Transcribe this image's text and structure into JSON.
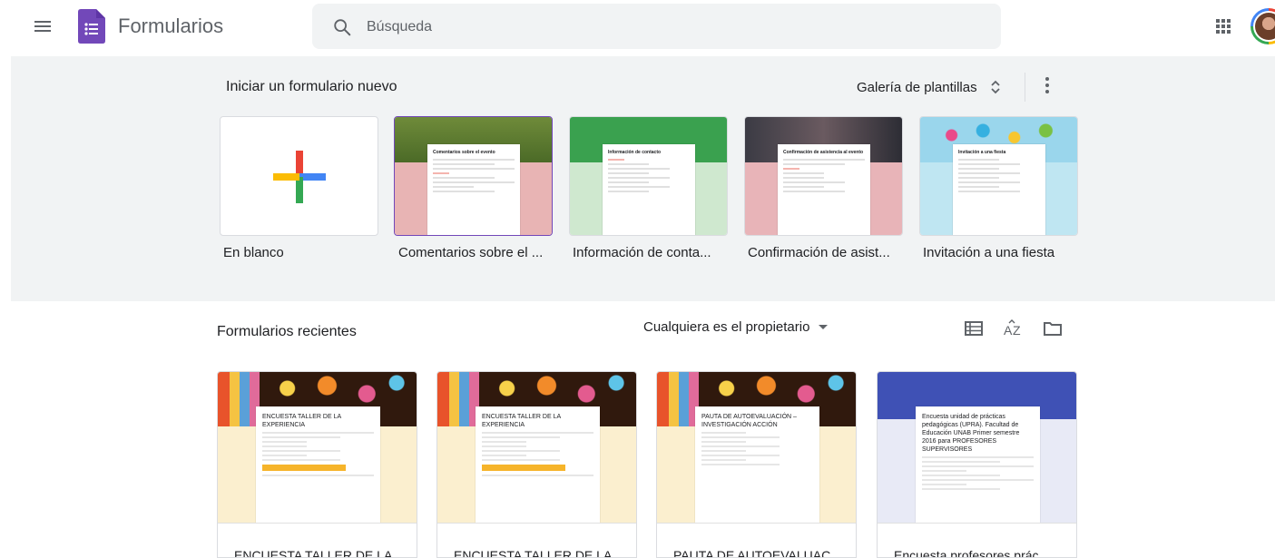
{
  "header": {
    "app_title": "Formularios",
    "search_placeholder": "Búsqueda"
  },
  "templates": {
    "heading": "Iniciar un formulario nuevo",
    "gallery_label": "Galería de plantillas",
    "items": [
      {
        "label": "En blanco"
      },
      {
        "label": "Comentarios sobre el ...",
        "thumb_title": "Comentarios sobre el evento"
      },
      {
        "label": "Información de conta...",
        "thumb_title": "Información de contacto"
      },
      {
        "label": "Confirmación de asist...",
        "thumb_title": "Confirmación de asistencia al evento"
      },
      {
        "label": "Invitación a una fiesta",
        "thumb_title": "Invitación a una fiesta"
      }
    ]
  },
  "recent": {
    "heading": "Formularios recientes",
    "owner_filter": "Cualquiera es el propietario",
    "items": [
      {
        "thumb_title": "ENCUESTA TALLER DE LA EXPERIENCIA",
        "title": "ENCUESTA TALLER DE LA ..."
      },
      {
        "thumb_title": "ENCUESTA TALLER DE LA EXPERIENCIA",
        "title": "ENCUESTA TALLER DE LA ..."
      },
      {
        "thumb_title": "PAUTA DE AUTOEVALUACIÓN – INVESTIGACIÓN ACCIÓN",
        "title": "PAUTA DE AUTOEVALUAC..."
      },
      {
        "thumb_title": "Encuesta unidad de prácticas pedagógicas (UPRA). Facultad de Educación UNAB Primer semestre 2016 para PROFESORES SUPERVISORES",
        "title": "Encuesta profesores prác..."
      }
    ]
  },
  "colors": {
    "accent": "#7248b9",
    "forms_purple": "#7248b9",
    "gray_bg": "#f1f3f4"
  }
}
